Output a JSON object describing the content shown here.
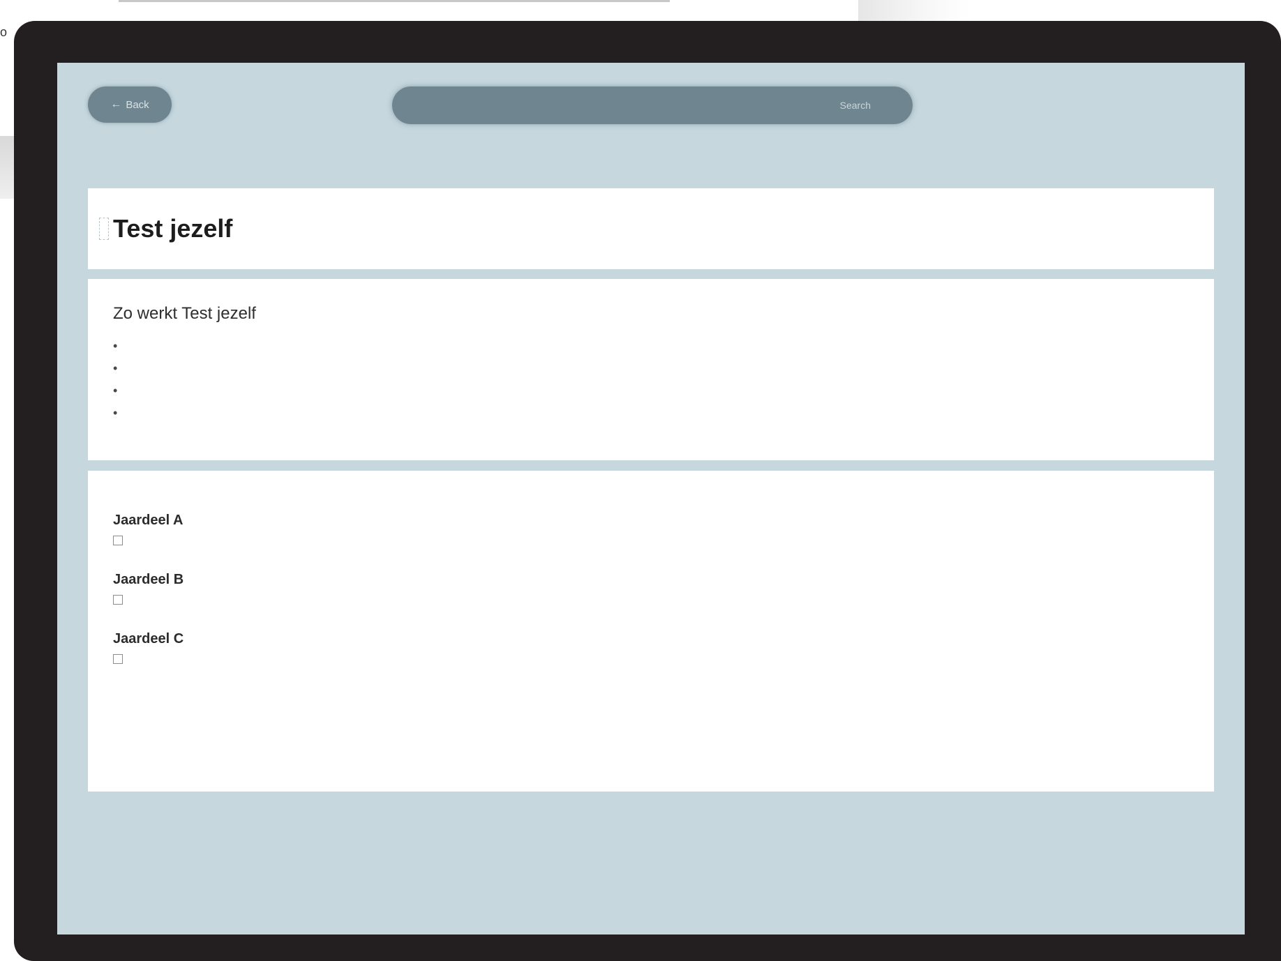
{
  "edge": {
    "left_text": "o"
  },
  "toolbar": {
    "back_label": "Back",
    "back_icon": "arrow-left-icon",
    "url_text": "",
    "search_label": "Search"
  },
  "page": {
    "title": "Test jezelf"
  },
  "instructions": {
    "heading": "Zo werkt Test jezelf",
    "bullets": [
      "",
      "",
      "",
      ""
    ]
  },
  "questions": {
    "section_label": "",
    "items": [
      {
        "title": "Jaardeel A",
        "option": ""
      },
      {
        "title": "Jaardeel B",
        "option": ""
      },
      {
        "title": "Jaardeel C",
        "option": ""
      }
    ]
  },
  "colors": {
    "frame": "#231f20",
    "screen_bg": "#c6d7de",
    "pill": "#6f8691",
    "card": "#ffffff"
  }
}
